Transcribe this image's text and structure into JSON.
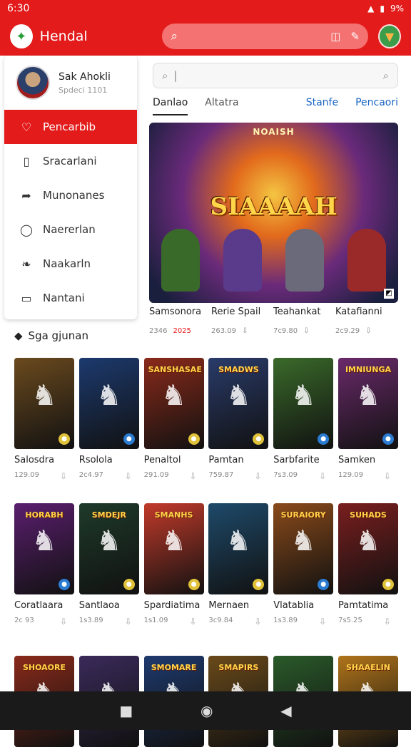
{
  "status": {
    "time": "6:30",
    "battery": "9%"
  },
  "app": {
    "title": "Hendal",
    "logo_icon": "app-logo-icon"
  },
  "top_search": {
    "placeholder": ""
  },
  "drawer": {
    "user_name": "Sak Ahokli",
    "user_sub": "Spdeci 1101",
    "items": [
      {
        "label": "Pencarbib",
        "icon": "heart-icon",
        "active": true
      },
      {
        "label": "Sracarlani",
        "icon": "bookmark-icon",
        "active": false
      },
      {
        "label": "Munonanes",
        "icon": "share-icon",
        "active": false
      },
      {
        "label": "Naererlan",
        "icon": "chat-icon",
        "active": false
      },
      {
        "label": "Naakarln",
        "icon": "leaf-icon",
        "active": false
      },
      {
        "label": "Nantani",
        "icon": "note-icon",
        "active": false
      }
    ]
  },
  "section": {
    "label": "Sga gjunan"
  },
  "search": {
    "placeholder": "|"
  },
  "tabs": [
    {
      "label": "Danlao",
      "active": true
    },
    {
      "label": "Altatra",
      "active": false
    },
    {
      "label": "Stanfe",
      "active": false
    },
    {
      "label": "Pencaori",
      "active": false
    }
  ],
  "hero": {
    "badge": "NOAISH",
    "title": "SIAAAAH"
  },
  "featured": [
    {
      "name": "Samsonora",
      "meta1": "2346",
      "meta2": "2025"
    },
    {
      "name": "Rerie Spail",
      "meta1": "263.09",
      "meta2": ""
    },
    {
      "name": "Teahankat",
      "meta1": "7c9.80",
      "meta2": ""
    },
    {
      "name": "Katafianni",
      "meta1": "2c9.29",
      "meta2": ""
    }
  ],
  "grid_rows": [
    [
      {
        "name": "Salosdra",
        "meta": "129.09",
        "banner": "",
        "color": "#6b4a1e",
        "accent": "#e0c23a"
      },
      {
        "name": "Rsolola",
        "meta": "2c4.97",
        "banner": "",
        "color": "#1c3a6e",
        "accent": "#2b7bd1"
      },
      {
        "name": "Penaltol",
        "meta": "291.09",
        "banner": "SANSHASAE",
        "color": "#8a2a1a",
        "accent": "#e0c23a"
      },
      {
        "name": "Pamtan",
        "meta": "759.87",
        "banner": "SMADWS",
        "color": "#2a3b6a",
        "accent": "#e0c23a"
      },
      {
        "name": "Sarbfarite",
        "meta": "7s3.09",
        "banner": "",
        "color": "#3a6a2a",
        "accent": "#2b7bd1"
      },
      {
        "name": "Samken",
        "meta": "129.09",
        "banner": "IMNIUNGA",
        "color": "#6a2a6a",
        "accent": "#2b7bd1"
      }
    ],
    [
      {
        "name": "Coratlaara",
        "meta": "2c 93",
        "banner": "HORABH",
        "color": "#5a1e6e",
        "accent": "#2b7bd1"
      },
      {
        "name": "Santlaoa",
        "meta": "1s3.89",
        "banner": "SMDEJR",
        "color": "#1e3a2a",
        "accent": "#e0c23a"
      },
      {
        "name": "Spardiatima",
        "meta": "1s1.09",
        "banner": "SMANHS",
        "color": "#c23a2a",
        "accent": "#e0c23a"
      },
      {
        "name": "Mernaen",
        "meta": "3c9.84",
        "banner": "",
        "color": "#1e4a6a",
        "accent": "#e0c23a"
      },
      {
        "name": "Vlatablia",
        "meta": "1s3.89",
        "banner": "SURAIORY",
        "color": "#8a4a1a",
        "accent": "#2b7bd1"
      },
      {
        "name": "Pamtatima",
        "meta": "7s5.25",
        "banner": "SUHADS",
        "color": "#7a1e1e",
        "accent": "#e0c23a"
      }
    ],
    [
      {
        "name": "",
        "meta": "",
        "banner": "SHOAORE",
        "color": "#8a2a1a",
        "accent": ""
      },
      {
        "name": "",
        "meta": "",
        "banner": "",
        "color": "#3a2a5a",
        "accent": ""
      },
      {
        "name": "",
        "meta": "",
        "banner": "SMOMARE",
        "color": "#1e3a6e",
        "accent": ""
      },
      {
        "name": "",
        "meta": "",
        "banner": "SMAPIRS",
        "color": "#6a4a1a",
        "accent": ""
      },
      {
        "name": "",
        "meta": "",
        "banner": "",
        "color": "#2a5a2a",
        "accent": ""
      },
      {
        "name": "",
        "meta": "",
        "banner": "SHAAELIN",
        "color": "#b0741a",
        "accent": ""
      }
    ]
  ]
}
